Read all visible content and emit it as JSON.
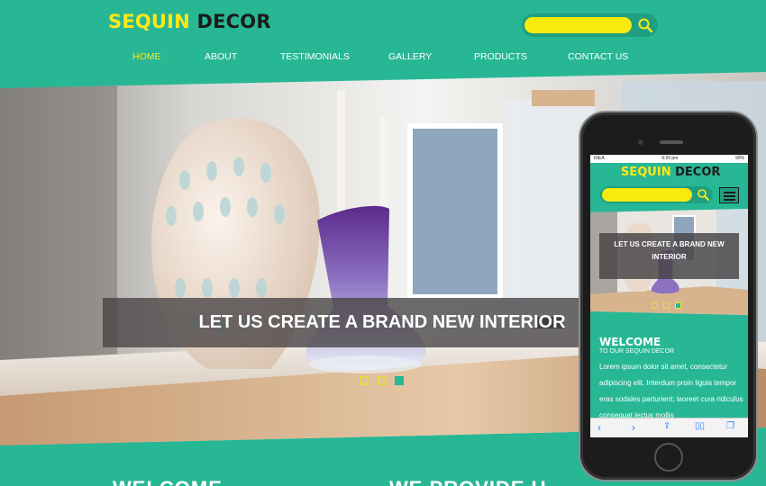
{
  "header": {
    "logo_part1": "SEQUIN",
    "logo_part2": "DECOR",
    "search_placeholder": "",
    "search_icon": "search-icon"
  },
  "nav": [
    {
      "label": "HOME",
      "active": true
    },
    {
      "label": "ABOUT",
      "active": false
    },
    {
      "label": "TESTIMONIALS",
      "active": false
    },
    {
      "label": "GALLERY",
      "active": false
    },
    {
      "label": "PRODUCTS",
      "active": false
    },
    {
      "label": "CONTACT US",
      "active": false
    }
  ],
  "hero": {
    "caption": "LET US CREATE A BRAND NEW INTERIOR",
    "slides_total": 3,
    "active_slide": 3
  },
  "sections": {
    "welcome_heading": "WELCOME",
    "provide_heading": "WE PROVIDE U"
  },
  "phone": {
    "status_carrier": "IDEA",
    "status_time": "9:20 pm",
    "status_battery": "90%",
    "logo_part1": "SEQUIN",
    "logo_part2": "DECOR",
    "hero_caption": "LET US CREATE A BRAND NEW INTERIOR",
    "welcome_title": "WELCOME",
    "welcome_subtitle": "TO OUR SEQUIN DECOR",
    "welcome_body": "Lorem ipsum dolor sit amet, consectetur adipiscing elit. Interdum proin ligula tempor eras sodales parturient; laoreet cura ridiculus consequat lectus mollis"
  },
  "colors": {
    "brand_teal": "#27b795",
    "accent_yellow": "#fde817",
    "dark_text": "#1b1b1b"
  }
}
